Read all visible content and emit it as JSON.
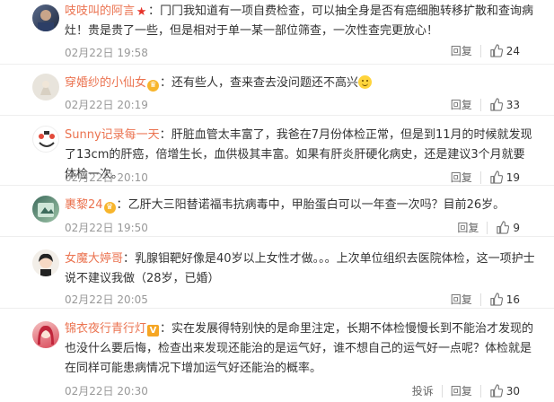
{
  "comments": [
    {
      "username": "吱吱叫的阿言",
      "badge": "star",
      "text": "冂冂我知道有一项自费检查，可以抽全身是否有癌细胞转移扩散和查询病灶！贵是贵了一些，但是相对于单一某一部位筛查，一次性查完更放心！",
      "time": "02月22日 19:58",
      "reply_label": "回复",
      "likes": "24"
    },
    {
      "username": "穿婚纱的小仙女",
      "badge": "crown",
      "text": "还有些人，查来查去没问题还不高兴",
      "emoji": "smile-emoji",
      "time": "02月22日 20:19",
      "reply_label": "回复",
      "likes": "33"
    },
    {
      "username": "Sunny记录每一天",
      "badge": "",
      "text": "肝脏血管太丰富了，我爸在7月份体检正常，但是到11月的时候就发现了13cm的肝癌，倍增生长，血供极其丰富。如果有肝炎肝硬化病史，还是建议3个月就要体检一次。",
      "time": "02月22日 20:10",
      "reply_label": "回复",
      "likes": "19"
    },
    {
      "username": "裹黎24",
      "badge": "crown",
      "text": "乙肝大三阳替诺福韦抗病毒中，甲胎蛋白可以一年查一次吗？目前26岁。",
      "time": "02月22日 19:50",
      "reply_label": "回复",
      "likes": "9"
    },
    {
      "username": "女魔大婷哥",
      "badge": "",
      "text": "乳腺钼靶好像是40岁以上女性才做。。。上次单位组织去医院体检，这一项护士说不建议我做（28岁，已婚）",
      "time": "02月22日 20:05",
      "reply_label": "回复",
      "likes": "16"
    },
    {
      "username": "锦衣夜行青行灯",
      "badge": "v",
      "text": "实在发展得特别快的是命里注定，长期不体检慢慢长到不能治才发现的也没什么要后悔，检查出来发现还能治的是运气好，谁不想自己的运气好一点呢？体检就是在同样可能患病情况下增加运气好还能治的概率。",
      "time": "02月22日 20:30",
      "complain_label": "投诉",
      "reply_label": "回复",
      "likes": "30"
    }
  ],
  "colors": {
    "username": "#eb7350",
    "meta": "#999999",
    "text": "#333333"
  }
}
